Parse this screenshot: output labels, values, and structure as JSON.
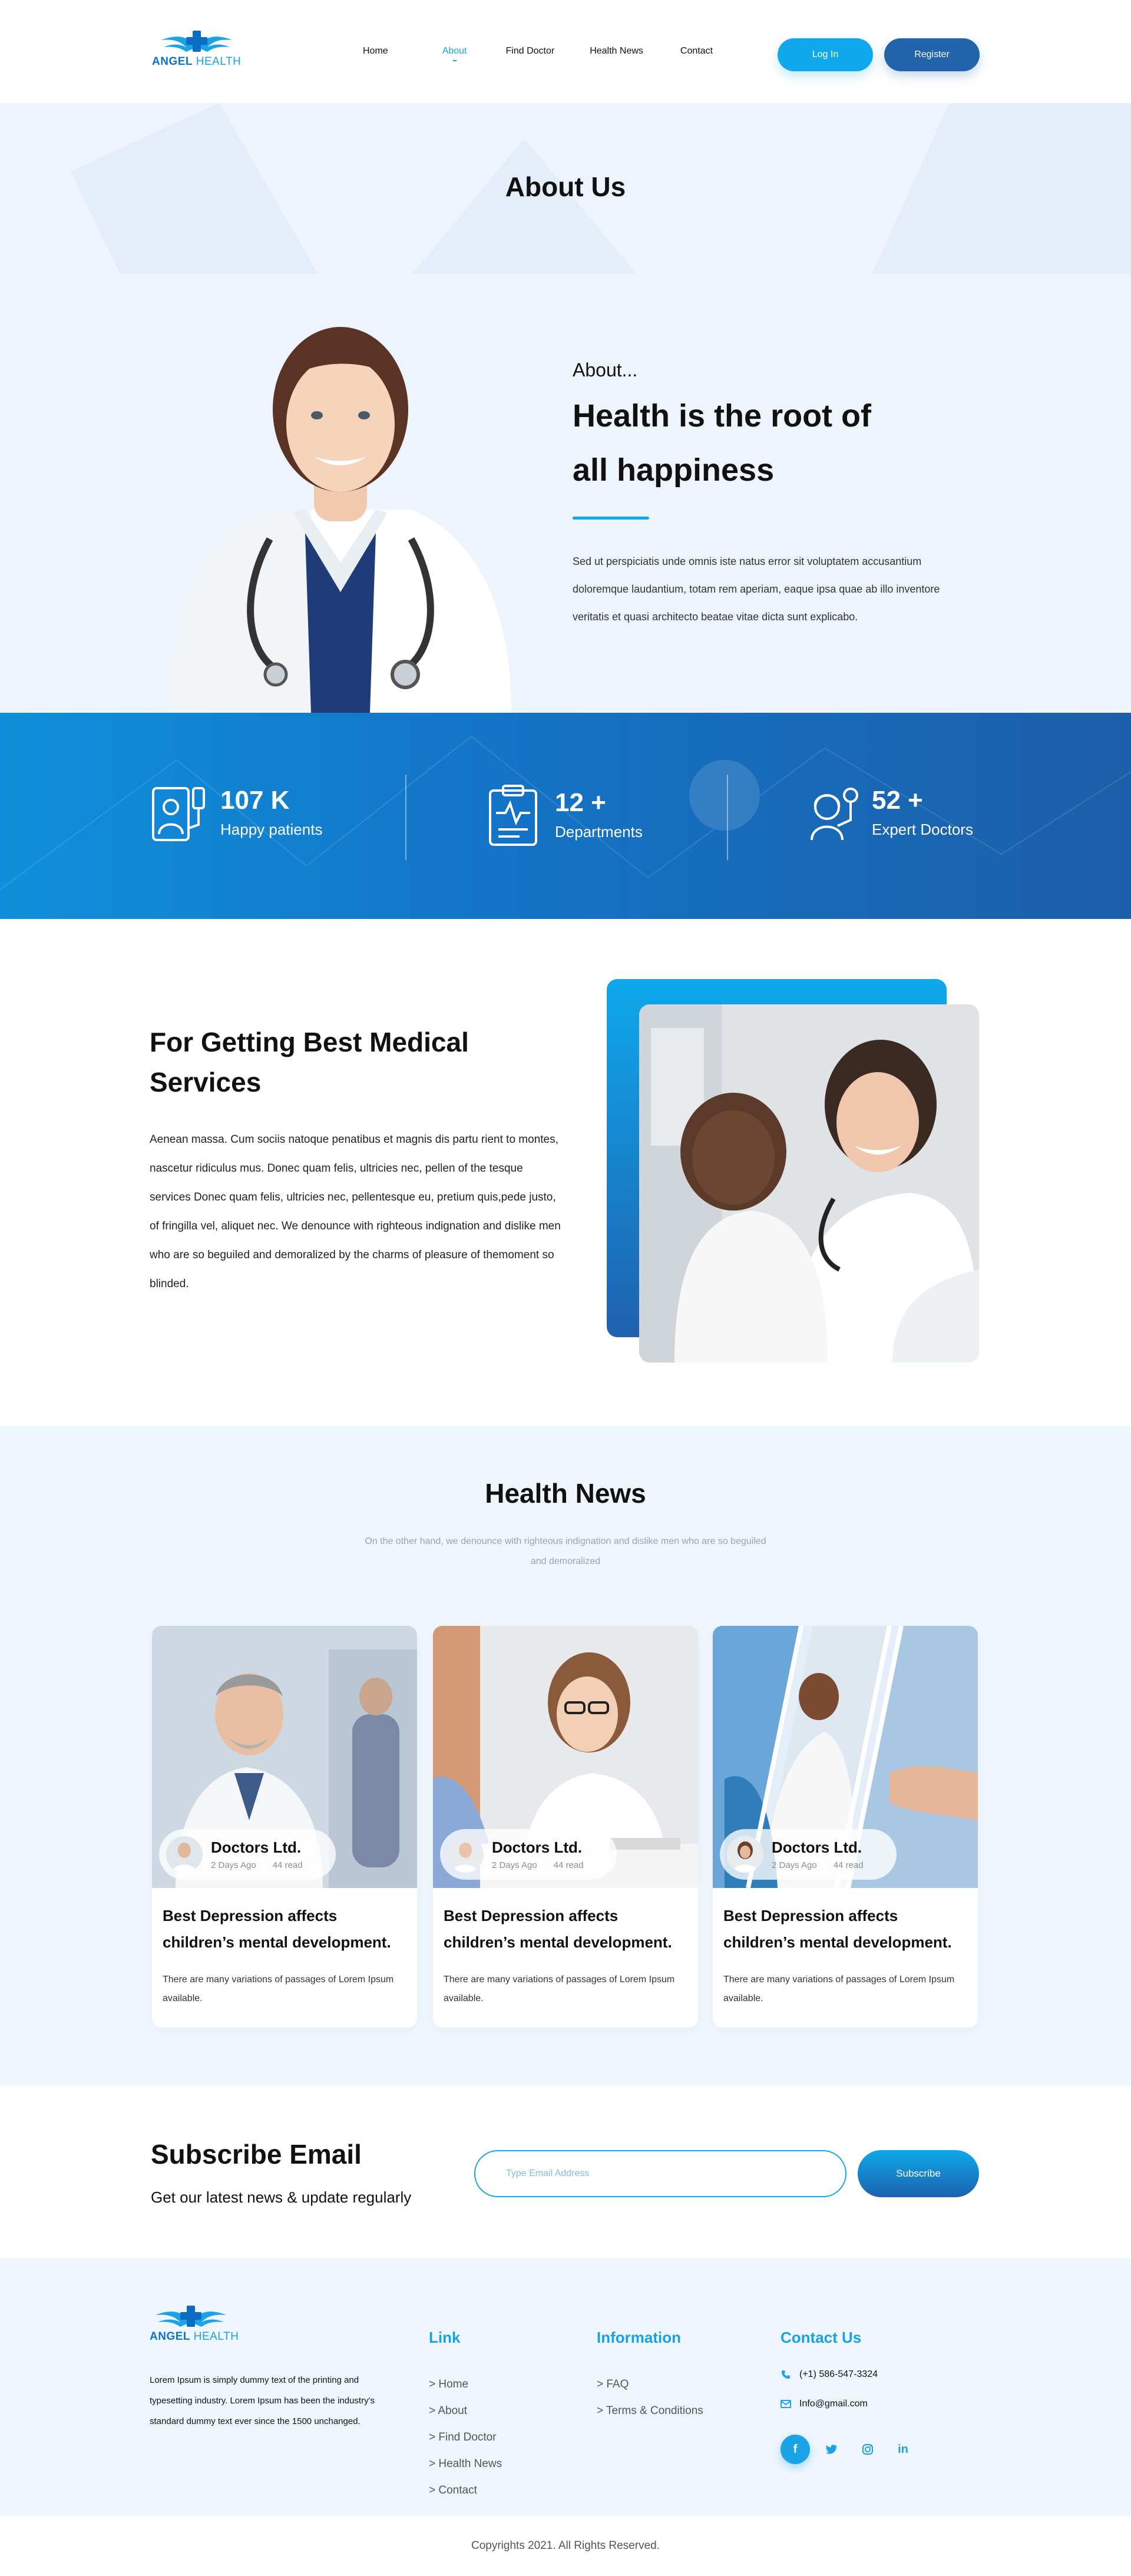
{
  "brand": {
    "logo_word1": "ANGEL",
    "logo_word2": "HEALTH"
  },
  "nav": {
    "items": [
      {
        "label": "Home"
      },
      {
        "label": "About",
        "active": true
      },
      {
        "label": "Find Doctor"
      },
      {
        "label": "Health News"
      },
      {
        "label": "Contact"
      }
    ],
    "login": "Log In",
    "register": "Register"
  },
  "page_title": "About Us",
  "about": {
    "kicker": "About...",
    "heading_line1": "Health is the root of",
    "heading_line2": "all happiness",
    "text": "Sed ut perspiciatis unde omnis iste natus error sit voluptatem accusantium doloremque laudantium, totam rem aperiam, eaque ipsa quae ab illo inventore veritatis et quasi architecto beatae vitae dicta sunt explicabo."
  },
  "stats": [
    {
      "value": "107 K",
      "label": "Happy patients",
      "icon": "patient-icon"
    },
    {
      "value": "12 +",
      "label": "Departments",
      "icon": "clipboard-icon"
    },
    {
      "value": "52 +",
      "label": "Expert Doctors",
      "icon": "doctor-icon"
    }
  ],
  "services": {
    "heading": "For Getting Best Medical Services",
    "text": "Aenean massa. Cum sociis natoque penatibus et magnis dis partu rient to montes, nascetur ridiculus mus. Donec quam felis, ultricies nec, pellen of the tesque services Donec quam felis, ultricies nec, pellentesque eu, pretium quis,pede justo, of fringilla vel, aliquet nec. We denounce with righteous indignation and dislike men who are so beguiled and demoralized by the charms of pleasure of themoment so blinded."
  },
  "news": {
    "title": "Health News",
    "subtitle": "On the other hand, we denounce with righteous indignation and dislike men who are so beguiled and demoralized",
    "cards": [
      {
        "brand": "Doctors Ltd.",
        "time": "2 Days Ago",
        "read": "44 read",
        "title": "Best Depression affects children’s mental development.",
        "text": "There are many variations of passages of Lorem Ipsum available."
      },
      {
        "brand": "Doctors Ltd.",
        "time": "2 Days Ago",
        "read": "44 read",
        "title": "Best Depression affects children’s mental development.",
        "text": "There are many variations of passages of Lorem Ipsum available."
      },
      {
        "brand": "Doctors Ltd.",
        "time": "2 Days Ago",
        "read": "44 read",
        "title": "Best Depression affects children’s mental development.",
        "text": "There are many variations of passages of Lorem Ipsum available."
      }
    ]
  },
  "subscribe": {
    "title": "Subscribe Email",
    "text": "Get our latest news & update regularly",
    "placeholder": "Type Email Address",
    "button": "Subscribe"
  },
  "footer": {
    "about": "Lorem Ipsum is simply dummy text of the printing and typesetting industry. Lorem Ipsum has been the industry's standard dummy text ever since the 1500 unchanged.",
    "link_title": "Link",
    "links": [
      "> Home",
      "> About",
      "> Find Doctor",
      "> Health News",
      "> Contact"
    ],
    "info_title": "Information",
    "info": [
      "> FAQ",
      "> Terms & Conditions"
    ],
    "contact_title": "Contact Us",
    "phone": "(+1) 586-547-3324",
    "email": "Info@gmail.com",
    "social": [
      "f",
      "t",
      "ig",
      "in"
    ],
    "copyright": "Copyrights 2021. All Rights Reserved."
  },
  "colors": {
    "accent": "#0fa8ec",
    "navy": "#2164ab",
    "bg_light": "#eef4fb"
  }
}
